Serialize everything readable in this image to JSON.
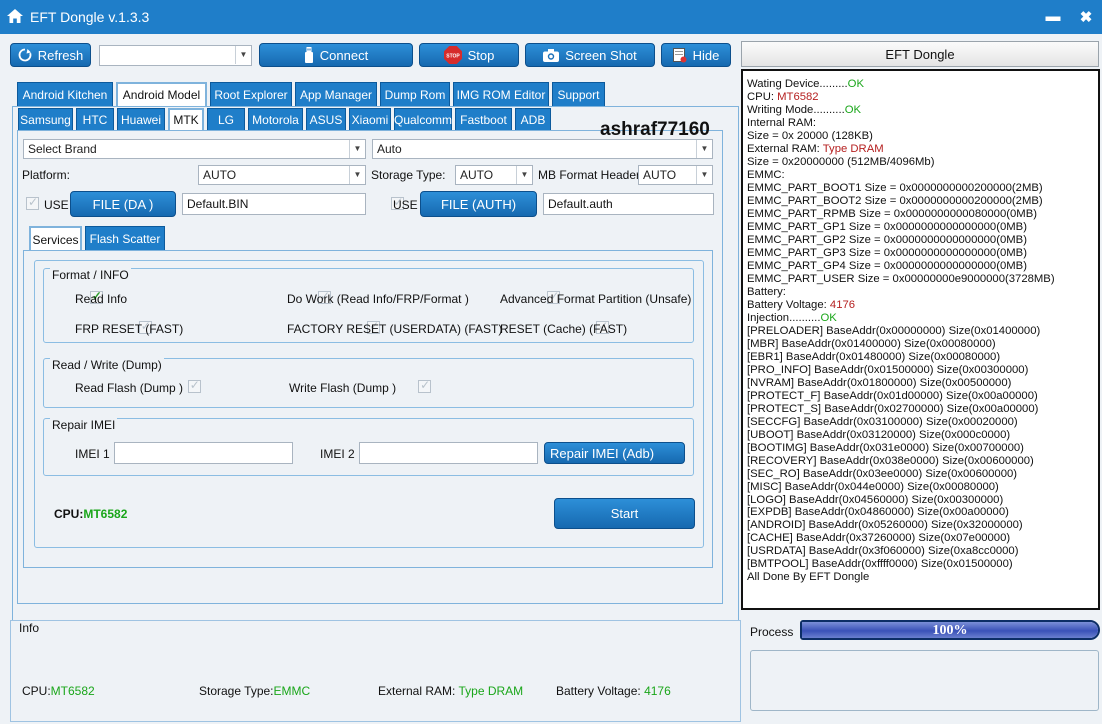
{
  "window": {
    "title": "EFT Dongle  v.1.3.3",
    "minimize": "▬",
    "close": "✖"
  },
  "toolbar": {
    "refresh": "Refresh",
    "port_value": "",
    "connect": "Connect",
    "stop": "Stop",
    "stop_sign": "STOP",
    "screenshot": "Screen Shot",
    "hide": "Hide"
  },
  "right_header": "EFT Dongle",
  "main_tabs": [
    "Android Kitchen",
    "Android Model",
    "Root Explorer",
    "App Manager",
    "Dump Rom",
    "IMG ROM Editor",
    "Support"
  ],
  "brand_tabs": [
    "Samsung",
    "HTC",
    "Huawei",
    "MTK",
    "LG",
    "Motorola",
    "ASUS",
    "Xiaomi",
    "Qualcomm",
    "Fastboot",
    "ADB"
  ],
  "watermark": "ashraf77160",
  "form": {
    "brand_select": "Select Brand",
    "model_select": "Auto",
    "platform_label": "Platform:",
    "platform_value": "AUTO",
    "storage_label": "Storage Type:",
    "storage_value": "AUTO",
    "mb_label": "MB Format Header",
    "mb_value": "AUTO",
    "use1": "USE",
    "file_da": "FILE (DA )",
    "da_value": "Default.BIN",
    "use2": "USE",
    "file_auth": "FILE (AUTH)",
    "auth_value": "Default.auth"
  },
  "sub_tabs": [
    "Services",
    "Flash Scatter"
  ],
  "format_group": {
    "title": "Format / INFO",
    "read_info": "Read Info",
    "do_work": "Do Work (Read Info/FRP/Format )",
    "adv_format": "Advanced Format Partition (Unsafe)",
    "frp_reset": "FRP RESET (FAST)",
    "factory_reset": "FACTORY RESET (USERDATA) (FAST)",
    "reset_cache": "RESET (Cache) (FAST)"
  },
  "rw_group": {
    "title": "Read / Write (Dump)",
    "read_flash": "Read Flash (Dump )",
    "write_flash": "Write Flash (Dump )"
  },
  "imei_group": {
    "title": "Repair IMEI",
    "imei1": "IMEI 1",
    "imei2": "IMEI 2",
    "imei1_value": "",
    "imei2_value": "",
    "repair_btn": "Repair IMEI (Adb)"
  },
  "cpu": {
    "label": "CPU:",
    "value": "MT6582"
  },
  "start": "Start",
  "log": {
    "l01": "Wating Device.........",
    "l01b": "OK",
    "l02": "CPU: ",
    "l02b": "MT6582",
    "l03": "Writing Mode..........",
    "l03b": "OK",
    "l04": "Internal RAM:",
    "l05": "Size = 0x 20000 (128KB)",
    "l06": "External RAM: ",
    "l06b": "Type DRAM",
    "l07": "Size = 0x20000000 (512MB/4096Mb)",
    "l08": "EMMC:",
    "l09": "EMMC_PART_BOOT1 Size = 0x0000000000200000(2MB)",
    "l10": "EMMC_PART_BOOT2 Size = 0x0000000000200000(2MB)",
    "l11": "EMMC_PART_RPMB Size = 0x0000000000080000(0MB)",
    "l12": "EMMC_PART_GP1 Size = 0x0000000000000000(0MB)",
    "l13": "EMMC_PART_GP2 Size = 0x0000000000000000(0MB)",
    "l14": "EMMC_PART_GP3 Size = 0x0000000000000000(0MB)",
    "l15": "EMMC_PART_GP4 Size = 0x0000000000000000(0MB)",
    "l16": "EMMC_PART_USER Size = 0x00000000e9000000(3728MB)",
    "l17": "Battery:",
    "l18": "Battery Voltage: ",
    "l18b": "4176",
    "l19": "Injection..........",
    "l19b": "OK",
    "l20": "[PRELOADER] BaseAddr(0x00000000) Size(0x01400000)",
    "l21": "[MBR] BaseAddr(0x01400000) Size(0x00080000)",
    "l22": "[EBR1] BaseAddr(0x01480000) Size(0x00080000)",
    "l23": "[PRO_INFO] BaseAddr(0x01500000) Size(0x00300000)",
    "l24": "[NVRAM] BaseAddr(0x01800000) Size(0x00500000)",
    "l25": "[PROTECT_F] BaseAddr(0x01d00000) Size(0x00a00000)",
    "l26": "[PROTECT_S] BaseAddr(0x02700000) Size(0x00a00000)",
    "l27": "[SECCFG] BaseAddr(0x03100000) Size(0x00020000)",
    "l28": "[UBOOT] BaseAddr(0x03120000) Size(0x000c0000)",
    "l29": "[BOOTIMG] BaseAddr(0x031e0000) Size(0x00700000)",
    "l30": "[RECOVERY] BaseAddr(0x038e0000) Size(0x00600000)",
    "l31": "[SEC_RO] BaseAddr(0x03ee0000) Size(0x00600000)",
    "l32": "[MISC] BaseAddr(0x044e0000) Size(0x00080000)",
    "l33": "[LOGO] BaseAddr(0x04560000) Size(0x00300000)",
    "l34": "[EXPDB] BaseAddr(0x04860000) Size(0x00a00000)",
    "l35": "[ANDROID] BaseAddr(0x05260000) Size(0x32000000)",
    "l36": "[CACHE] BaseAddr(0x37260000) Size(0x07e00000)",
    "l37": "[USRDATA] BaseAddr(0x3f060000) Size(0xa8cc0000)",
    "l38": "[BMTPOOL] BaseAddr(0xffff0000) Size(0x01500000)",
    "l39": "All Done By EFT Dongle"
  },
  "info": {
    "title": "Info",
    "cpu_label": "CPU:",
    "cpu_value": "MT6582",
    "storage_label": "Storage Type:",
    "storage_value": "EMMC",
    "ram_label": "External RAM: ",
    "ram_value": "Type DRAM",
    "batt_label": "Battery Voltage: ",
    "batt_value": "4176"
  },
  "process": {
    "label": "Process",
    "percent": 100,
    "percent_text": "100%"
  },
  "colors": {
    "accent": "#1f7ec9",
    "ok": "#1aa61a",
    "red": "#b52020"
  }
}
